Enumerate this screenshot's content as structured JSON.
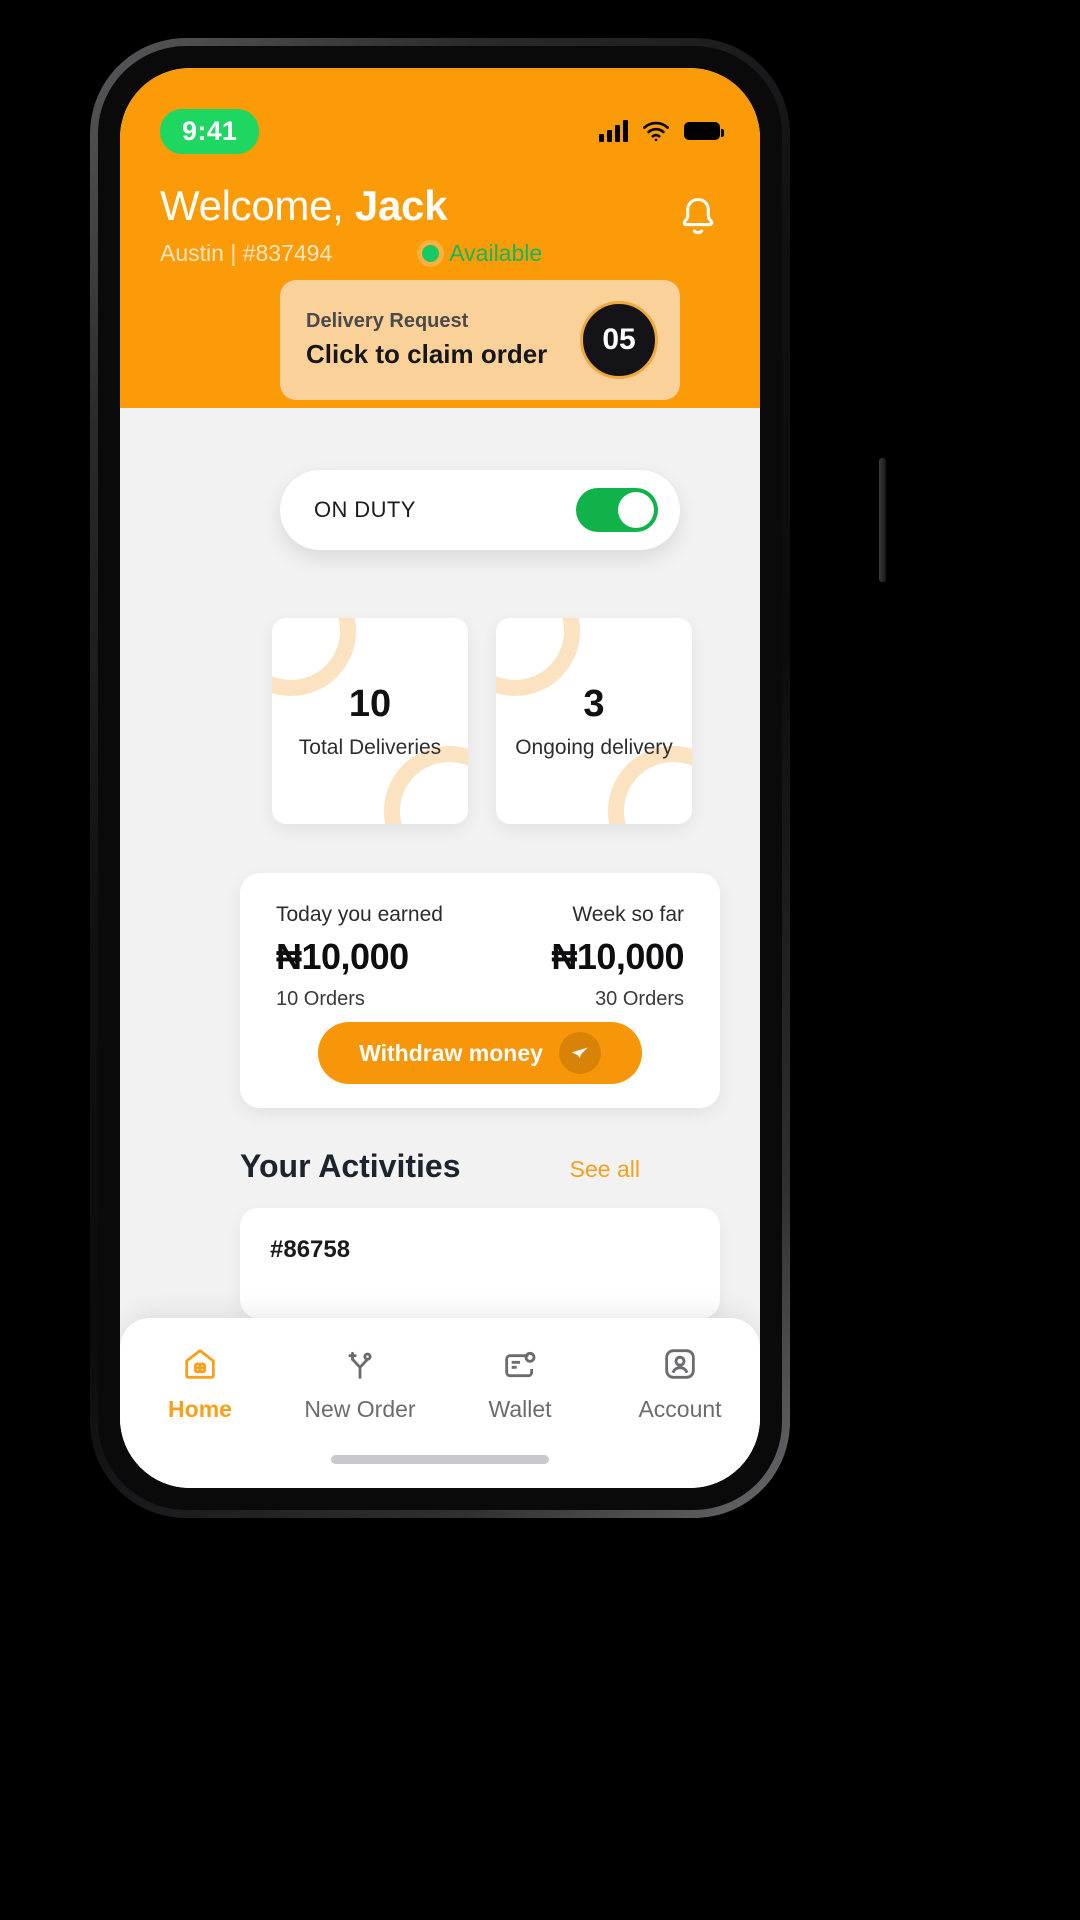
{
  "status_bar": {
    "time": "9:41",
    "signal_icon": "cellular-signal-icon",
    "wifi_icon": "wifi-icon",
    "battery_icon": "battery-icon"
  },
  "header": {
    "greeting_prefix": "Welcome, ",
    "user_name": "Jack",
    "location": "Austin",
    "separator": " | ",
    "rider_id": "#837494",
    "availability": "Available",
    "bell_icon": "notification-bell-icon",
    "bg_color": "#fb9b07"
  },
  "delivery_request": {
    "title": "Delivery Request",
    "action": "Click to claim order",
    "countdown": "05",
    "card_color": "#fbd19a"
  },
  "duty": {
    "label": "ON DUTY",
    "enabled": true,
    "toggle_color": "#12b24b"
  },
  "stats": [
    {
      "value": "10",
      "label": "Total Deliveries"
    },
    {
      "value": "3",
      "label": "Ongoing delivery"
    }
  ],
  "earnings": {
    "today_label": "Today you earned",
    "today_amount": "₦10,000",
    "today_orders": "10 Orders",
    "week_label": "Week so far",
    "week_amount": "₦10,000",
    "week_orders": "30 Orders",
    "withdraw_label": "Withdraw money",
    "withdraw_icon": "send-plane-icon",
    "button_color": "#f8960a"
  },
  "activities": {
    "title": "Your Activities",
    "see_all": "See all",
    "items": [
      {
        "order_id": "#86758"
      }
    ]
  },
  "tabbar": {
    "items": [
      {
        "label": "Home",
        "icon": "home-icon",
        "active": true
      },
      {
        "label": "New Order",
        "icon": "route-fork-icon",
        "active": false
      },
      {
        "label": "Wallet",
        "icon": "wallet-icon",
        "active": false
      },
      {
        "label": "Account",
        "icon": "user-account-icon",
        "active": false
      }
    ],
    "active_color": "#f6a01e",
    "inactive_color": "#6c6c70"
  }
}
